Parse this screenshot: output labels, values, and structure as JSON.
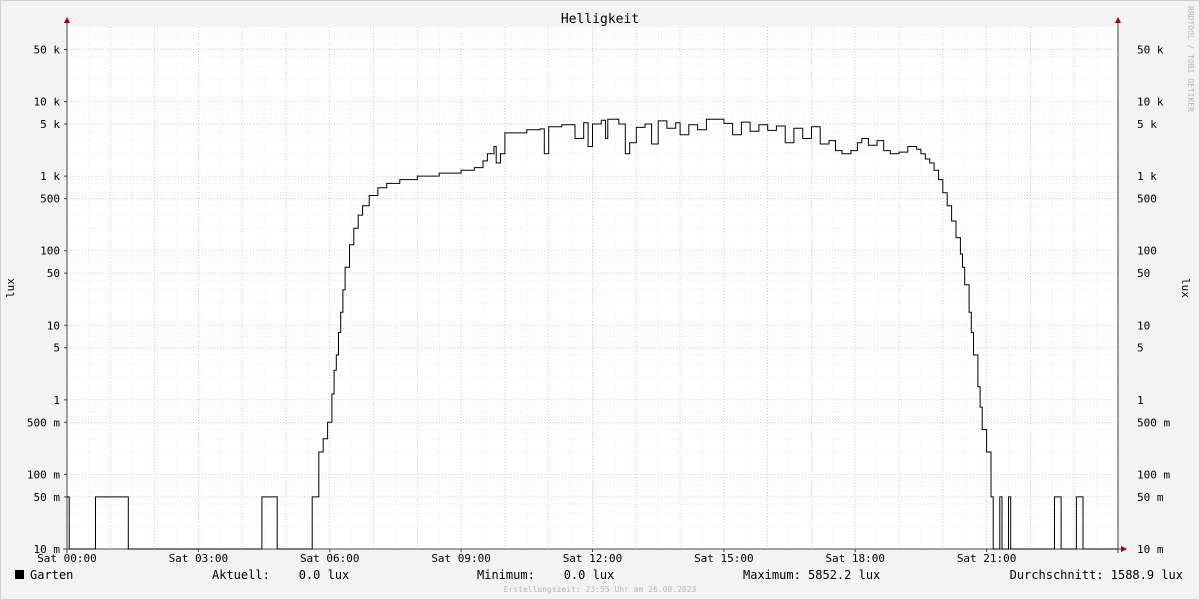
{
  "chart_data": {
    "type": "line",
    "title": "Helligkeit",
    "ylabel": "lux",
    "yscale": "log",
    "ylim": [
      0.01,
      100000
    ],
    "xlim": [
      0,
      24
    ],
    "y_ticks": [
      {
        "value": 0.01,
        "label": "10 m"
      },
      {
        "value": 0.05,
        "label": "50 m"
      },
      {
        "value": 0.1,
        "label": "100 m"
      },
      {
        "value": 0.5,
        "label": "500 m"
      },
      {
        "value": 1,
        "label": "1"
      },
      {
        "value": 5,
        "label": "5"
      },
      {
        "value": 10,
        "label": "10"
      },
      {
        "value": 50,
        "label": "50"
      },
      {
        "value": 100,
        "label": "100"
      },
      {
        "value": 500,
        "label": "500"
      },
      {
        "value": 1000,
        "label": "1 k"
      },
      {
        "value": 5000,
        "label": "5 k"
      },
      {
        "value": 10000,
        "label": "10 k"
      },
      {
        "value": 50000,
        "label": "50 k"
      }
    ],
    "x_ticks": [
      {
        "value": 0,
        "label": "Sat 00:00"
      },
      {
        "value": 3,
        "label": "Sat 03:00"
      },
      {
        "value": 6,
        "label": "Sat 06:00"
      },
      {
        "value": 9,
        "label": "Sat 09:00"
      },
      {
        "value": 12,
        "label": "Sat 12:00"
      },
      {
        "value": 15,
        "label": "Sat 15:00"
      },
      {
        "value": 18,
        "label": "Sat 18:00"
      },
      {
        "value": 21,
        "label": "Sat 21:00"
      }
    ],
    "grid": true,
    "series": [
      {
        "name": "Garten",
        "color": "#000000",
        "points": [
          [
            0,
            0.05
          ],
          [
            0.05,
            0.01
          ],
          [
            0.65,
            0.01
          ],
          [
            0.65,
            0.05
          ],
          [
            1.4,
            0.05
          ],
          [
            1.4,
            0.01
          ],
          [
            4.45,
            0.01
          ],
          [
            4.45,
            0.05
          ],
          [
            4.8,
            0.05
          ],
          [
            4.8,
            0.01
          ],
          [
            5.6,
            0.01
          ],
          [
            5.6,
            0.05
          ],
          [
            5.75,
            0.05
          ],
          [
            5.75,
            0.2
          ],
          [
            5.85,
            0.3
          ],
          [
            5.95,
            0.5
          ],
          [
            6.05,
            1.2
          ],
          [
            6.1,
            2.5
          ],
          [
            6.15,
            4
          ],
          [
            6.2,
            8
          ],
          [
            6.25,
            15
          ],
          [
            6.3,
            30
          ],
          [
            6.35,
            60
          ],
          [
            6.45,
            120
          ],
          [
            6.55,
            200
          ],
          [
            6.65,
            300
          ],
          [
            6.75,
            400
          ],
          [
            6.9,
            550
          ],
          [
            7.1,
            700
          ],
          [
            7.3,
            800
          ],
          [
            7.6,
            900
          ],
          [
            8,
            1000
          ],
          [
            8.5,
            1100
          ],
          [
            9,
            1200
          ],
          [
            9.3,
            1300
          ],
          [
            9.5,
            1600
          ],
          [
            9.6,
            2000
          ],
          [
            9.75,
            2500
          ],
          [
            9.8,
            1500
          ],
          [
            9.9,
            2000
          ],
          [
            10,
            3800
          ],
          [
            10.5,
            4200
          ],
          [
            10.8,
            4300
          ],
          [
            10.9,
            2000
          ],
          [
            11,
            4600
          ],
          [
            11.3,
            4900
          ],
          [
            11.6,
            3200
          ],
          [
            11.8,
            5200
          ],
          [
            11.9,
            2500
          ],
          [
            12,
            5000
          ],
          [
            12.2,
            5600
          ],
          [
            12.3,
            3200
          ],
          [
            12.35,
            5800
          ],
          [
            12.6,
            5000
          ],
          [
            12.75,
            2000
          ],
          [
            12.85,
            2800
          ],
          [
            13,
            4500
          ],
          [
            13.2,
            5000
          ],
          [
            13.35,
            2700
          ],
          [
            13.5,
            5500
          ],
          [
            13.7,
            4400
          ],
          [
            13.9,
            5200
          ],
          [
            14,
            3600
          ],
          [
            14.2,
            4900
          ],
          [
            14.4,
            4200
          ],
          [
            14.6,
            5800
          ],
          [
            15,
            5100
          ],
          [
            15.2,
            3600
          ],
          [
            15.4,
            5300
          ],
          [
            15.6,
            4000
          ],
          [
            15.8,
            4900
          ],
          [
            16,
            4100
          ],
          [
            16.2,
            4700
          ],
          [
            16.4,
            2800
          ],
          [
            16.6,
            4400
          ],
          [
            16.8,
            3200
          ],
          [
            17,
            4600
          ],
          [
            17.2,
            2700
          ],
          [
            17.4,
            3000
          ],
          [
            17.55,
            2200
          ],
          [
            17.7,
            2000
          ],
          [
            17.9,
            2200
          ],
          [
            18.05,
            2800
          ],
          [
            18.15,
            3200
          ],
          [
            18.3,
            2600
          ],
          [
            18.5,
            3000
          ],
          [
            18.65,
            2200
          ],
          [
            18.8,
            2000
          ],
          [
            19,
            2100
          ],
          [
            19.2,
            2500
          ],
          [
            19.4,
            2300
          ],
          [
            19.5,
            2000
          ],
          [
            19.6,
            1700
          ],
          [
            19.7,
            1500
          ],
          [
            19.8,
            1200
          ],
          [
            19.9,
            900
          ],
          [
            20,
            600
          ],
          [
            20.1,
            400
          ],
          [
            20.2,
            250
          ],
          [
            20.3,
            150
          ],
          [
            20.4,
            90
          ],
          [
            20.45,
            60
          ],
          [
            20.5,
            35
          ],
          [
            20.6,
            15
          ],
          [
            20.65,
            8
          ],
          [
            20.7,
            4
          ],
          [
            20.8,
            1.5
          ],
          [
            20.85,
            0.8
          ],
          [
            20.9,
            0.4
          ],
          [
            21,
            0.2
          ],
          [
            21.1,
            0.05
          ],
          [
            21.15,
            0.01
          ],
          [
            21.3,
            0.01
          ],
          [
            21.3,
            0.05
          ],
          [
            21.35,
            0.05
          ],
          [
            21.35,
            0.01
          ],
          [
            21.5,
            0.01
          ],
          [
            21.5,
            0.05
          ],
          [
            21.55,
            0.05
          ],
          [
            21.55,
            0.01
          ],
          [
            22.55,
            0.01
          ],
          [
            22.55,
            0.05
          ],
          [
            22.7,
            0.05
          ],
          [
            22.7,
            0.01
          ],
          [
            23.05,
            0.01
          ],
          [
            23.05,
            0.05
          ],
          [
            23.2,
            0.05
          ],
          [
            23.2,
            0.01
          ],
          [
            24,
            0.01
          ]
        ]
      }
    ]
  },
  "legend": {
    "series_name": "Garten",
    "aktuell": "Aktuell:    0.0 lux",
    "minimum": "Minimum:    0.0 lux",
    "maximum": "Maximum: 5852.2 lux",
    "durchschnitt": "Durchschnitt: 1588.9 lux"
  },
  "footer": "Erstellungszeit: 23:55 Uhr am 26.08.2023",
  "watermark": "RRDTOOL / TOBI OETIKER"
}
